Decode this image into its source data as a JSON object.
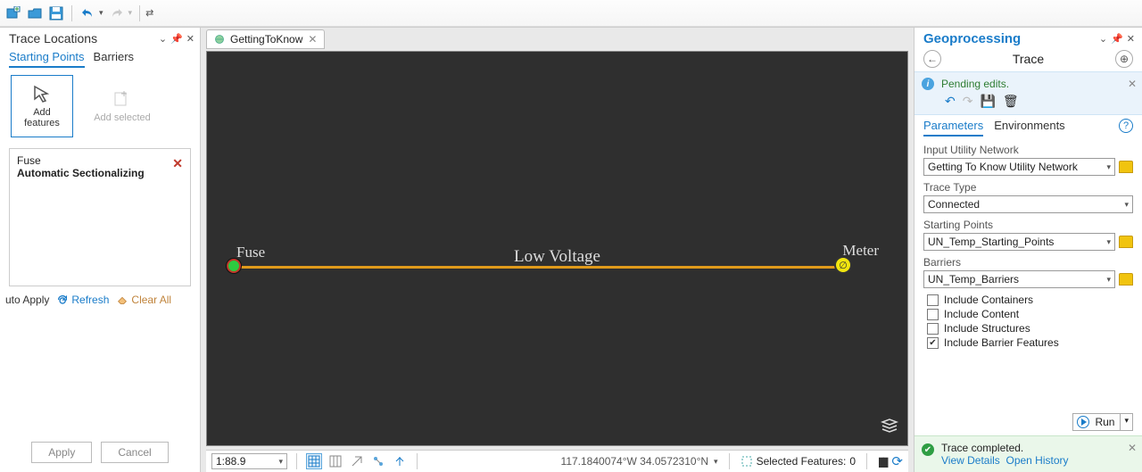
{
  "left": {
    "title": "Trace Locations",
    "tabs": {
      "starting": "Starting Points",
      "barriers": "Barriers"
    },
    "tools": {
      "add_features": "Add\nfeatures",
      "add_selected": "Add selected"
    },
    "feature": {
      "line1": "Fuse",
      "line2": "Automatic Sectionalizing"
    },
    "links": {
      "auto_apply": "uto Apply",
      "refresh": "Refresh",
      "clear_all": "Clear All"
    },
    "buttons": {
      "apply": "Apply",
      "cancel": "Cancel"
    }
  },
  "center": {
    "tab": "GettingToKnow",
    "labels": {
      "fuse": "Fuse",
      "low_voltage": "Low Voltage",
      "meter": "Meter"
    },
    "scale": "1:88.9",
    "coords": "117.1840074°W 34.0572310°N",
    "selected_label": "Selected Features:",
    "selected_count": "0"
  },
  "right": {
    "pane_title": "Geoprocessing",
    "tool_title": "Trace",
    "pending_title": "Pending edits.",
    "tabs": {
      "params": "Parameters",
      "envs": "Environments"
    },
    "fields": {
      "input_label": "Input Utility Network",
      "input_value": "Getting To Know Utility Network",
      "trace_type_label": "Trace Type",
      "trace_type_value": "Connected",
      "starting_label": "Starting Points",
      "starting_value": "UN_Temp_Starting_Points",
      "barriers_label": "Barriers",
      "barriers_value": "UN_Temp_Barriers"
    },
    "checks": {
      "containers": "Include Containers",
      "content": "Include Content",
      "structures": "Include Structures",
      "barrier_features": "Include Barrier Features"
    },
    "run": "Run",
    "complete": {
      "title": "Trace completed.",
      "view_details": "View Details",
      "open_history": "Open History"
    }
  }
}
